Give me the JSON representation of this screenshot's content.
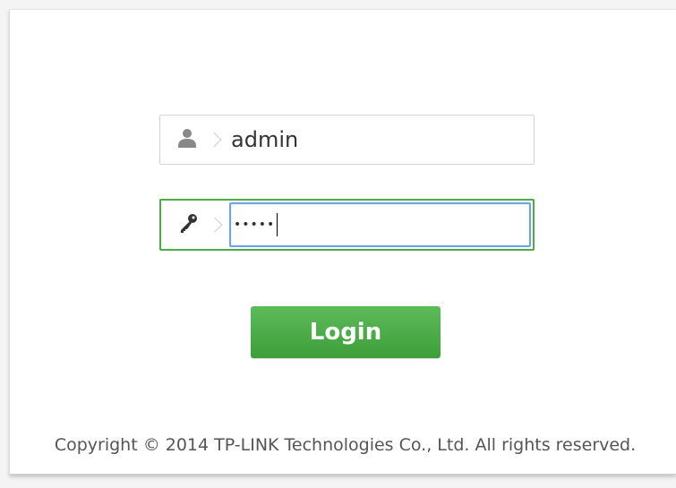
{
  "login_form": {
    "username": {
      "value": "admin",
      "icon": "user-icon"
    },
    "password": {
      "masked_value": "•••••",
      "icon": "key-icon"
    },
    "login_button_label": "Login"
  },
  "footer": {
    "copyright": "Copyright © 2014 TP-LINK Technologies Co., Ltd. All rights reserved."
  },
  "colors": {
    "accent_green": "#4caa49",
    "focus_blue": "#6ea4e4"
  }
}
